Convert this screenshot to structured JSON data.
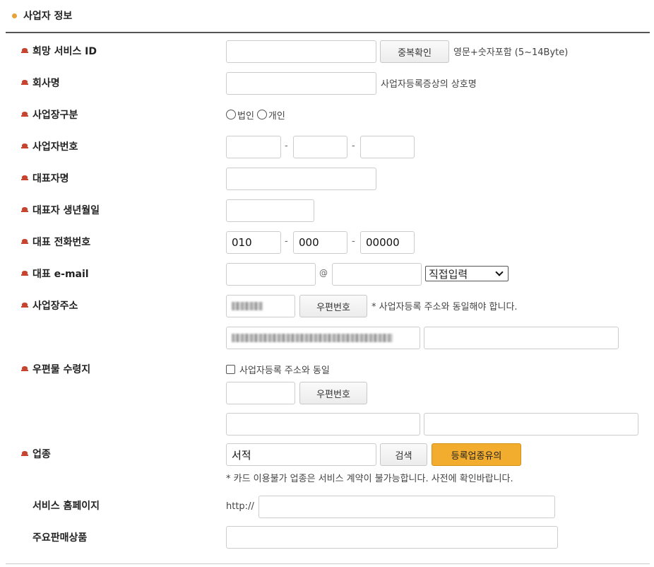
{
  "section": {
    "title": "사업자 정보"
  },
  "fields": {
    "service_id": {
      "label": "희망 서비스 ID",
      "button": "중복확인",
      "hint": "영문+숫자포함 (5~14Byte)"
    },
    "company_name": {
      "label": "회사명",
      "hint": "사업자등록증상의 상호명"
    },
    "business_type": {
      "label": "사업장구분",
      "options": [
        "법인",
        "개인"
      ]
    },
    "business_number": {
      "label": "사업자번호"
    },
    "ceo_name": {
      "label": "대표자명"
    },
    "ceo_birth": {
      "label": "대표자 생년월일"
    },
    "phone": {
      "label": "대표 전화번호",
      "part1": "010",
      "part2": "000",
      "part3": "00000"
    },
    "email": {
      "label": "대표 e-mail",
      "at": "@",
      "domain_select": "직접입력"
    },
    "address": {
      "label": "사업장주소",
      "button": "우편번호",
      "hint": "* 사업자등록 주소와 동일해야 합니다."
    },
    "mail_address": {
      "label": "우편물 수령지",
      "same_label": "사업자등록 주소와 동일",
      "button": "우편번호"
    },
    "industry": {
      "label": "업종",
      "value": "서적",
      "search_button": "검색",
      "caution_button": "등록업종유의",
      "notice": "* 카드 이용불가 업종은 서비스 계약이 불가능합니다. 사전에 확인바랍니다."
    },
    "homepage": {
      "label": "서비스 홈페이지",
      "prefix": "http://"
    },
    "products": {
      "label": "주요판매상품"
    }
  }
}
